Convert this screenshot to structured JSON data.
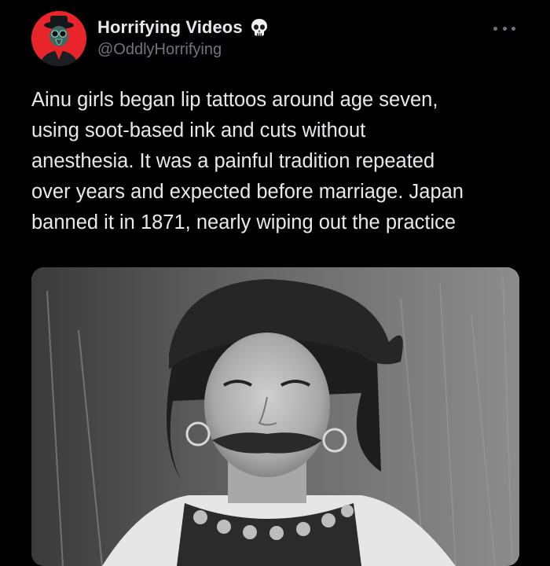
{
  "author": {
    "display_name": "Horrifying Videos",
    "handle": "@OddlyHorrifying",
    "badge_icon": "skull-icon",
    "avatar_color": "#e8252b"
  },
  "menu": {
    "icon": "more-horizontal-icon"
  },
  "tweet": {
    "lines": [
      "Ainu girls began lip tattoos around age seven,",
      "using soot-based ink and cuts without",
      "anesthesia. It was a painful tradition repeated",
      "over years and expected before marriage. Japan",
      "banned it in 1871, nearly wiping out the practice"
    ]
  },
  "media": {
    "kind": "black-and-white photograph of an Ainu woman with a lip tattoo"
  },
  "colors": {
    "background": "#000000",
    "text": "#e7e9ea",
    "secondary": "#71767b"
  }
}
